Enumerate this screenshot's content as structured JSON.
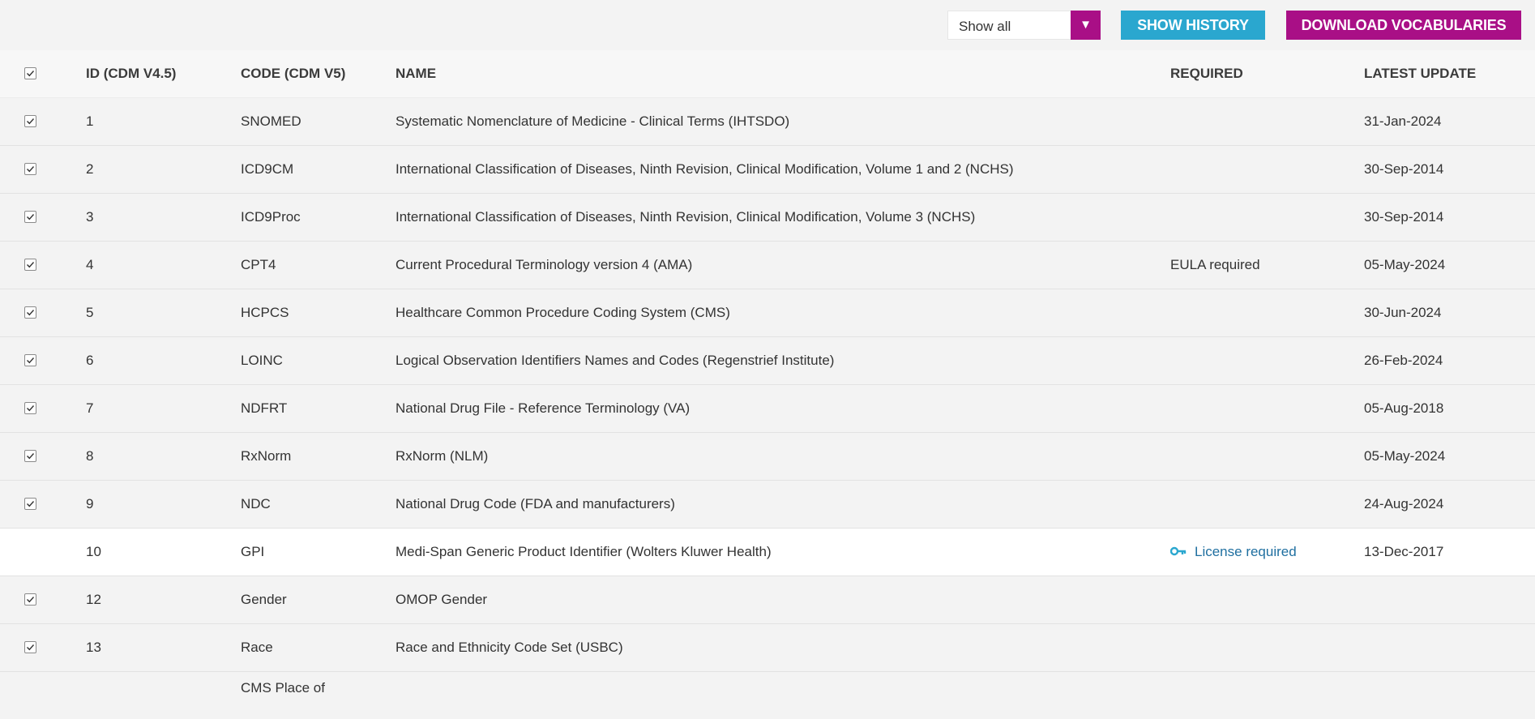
{
  "toolbar": {
    "filter_value": "Show all",
    "filter_arrow": "▼",
    "show_history": "SHOW HISTORY",
    "download": "DOWNLOAD VOCABULARIES"
  },
  "headers": {
    "id": "ID (CDM V4.5)",
    "code": "CODE (CDM V5)",
    "name": "NAME",
    "required": "REQUIRED",
    "latest_update": "LATEST UPDATE"
  },
  "rows": [
    {
      "checked": true,
      "id": "1",
      "code": "SNOMED",
      "name": "Systematic Nomenclature of Medicine - Clinical Terms (IHTSDO)",
      "required": "",
      "updated": "31-Jan-2024"
    },
    {
      "checked": true,
      "id": "2",
      "code": "ICD9CM",
      "name": "International Classification of Diseases, Ninth Revision, Clinical Modification, Volume 1 and 2 (NCHS)",
      "required": "",
      "updated": "30-Sep-2014"
    },
    {
      "checked": true,
      "id": "3",
      "code": "ICD9Proc",
      "name": "International Classification of Diseases, Ninth Revision, Clinical Modification, Volume 3 (NCHS)",
      "required": "",
      "updated": "30-Sep-2014"
    },
    {
      "checked": true,
      "id": "4",
      "code": "CPT4",
      "name": "Current Procedural Terminology version 4 (AMA)",
      "required": "EULA required",
      "updated": "05-May-2024"
    },
    {
      "checked": true,
      "id": "5",
      "code": "HCPCS",
      "name": "Healthcare Common Procedure Coding System (CMS)",
      "required": "",
      "updated": "30-Jun-2024"
    },
    {
      "checked": true,
      "id": "6",
      "code": "LOINC",
      "name": "Logical Observation Identifiers Names and Codes (Regenstrief Institute)",
      "required": "",
      "updated": "26-Feb-2024"
    },
    {
      "checked": true,
      "id": "7",
      "code": "NDFRT",
      "name": "National Drug File - Reference Terminology (VA)",
      "required": "",
      "updated": "05-Aug-2018"
    },
    {
      "checked": true,
      "id": "8",
      "code": "RxNorm",
      "name": "RxNorm (NLM)",
      "required": "",
      "updated": "05-May-2024"
    },
    {
      "checked": true,
      "id": "9",
      "code": "NDC",
      "name": "National Drug Code (FDA and manufacturers)",
      "required": "",
      "updated": "24-Aug-2024"
    },
    {
      "checked": false,
      "id": "10",
      "code": "GPI",
      "name": "Medi-Span Generic Product Identifier (Wolters Kluwer Health)",
      "required": "License required",
      "updated": "13-Dec-2017"
    },
    {
      "checked": true,
      "id": "12",
      "code": "Gender",
      "name": "OMOP Gender",
      "required": "",
      "updated": ""
    },
    {
      "checked": true,
      "id": "13",
      "code": "Race",
      "name": "Race and Ethnicity Code Set (USBC)",
      "required": "",
      "updated": ""
    }
  ],
  "partial_row": {
    "code": "CMS Place of"
  },
  "colors": {
    "accent_magenta": "#a90f86",
    "accent_blue": "#2aa7cf",
    "license_blue": "#1f6fa0"
  },
  "icons": {
    "license": "key-icon",
    "checkbox": "checkmark-icon"
  }
}
